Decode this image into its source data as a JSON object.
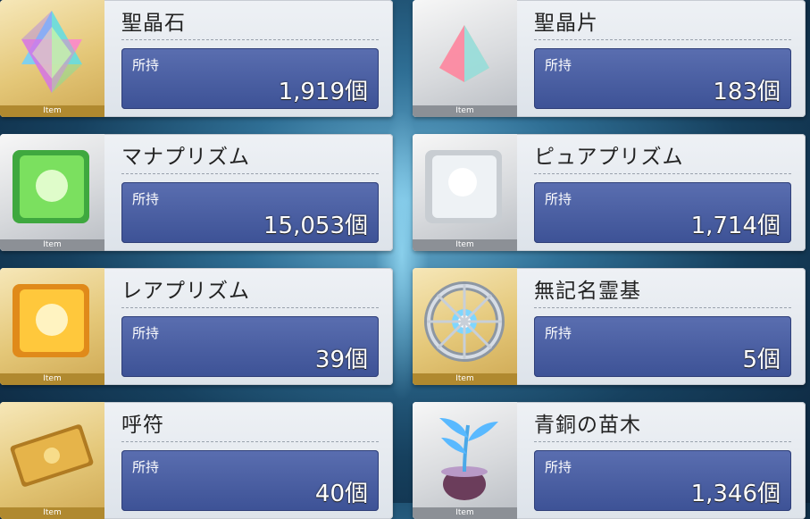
{
  "items": [
    {
      "name": "聖晶石",
      "own_label": "所持",
      "count": "1,919個",
      "tag": "Item",
      "icon": "saint-quartz-icon"
    },
    {
      "name": "聖晶片",
      "own_label": "所持",
      "count": "183個",
      "tag": "Item",
      "icon": "quartz-fragment-icon"
    },
    {
      "name": "マナプリズム",
      "own_label": "所持",
      "count": "15,053個",
      "tag": "Item",
      "icon": "mana-prism-icon"
    },
    {
      "name": "ピュアプリズム",
      "own_label": "所持",
      "count": "1,714個",
      "tag": "Item",
      "icon": "pure-prism-icon"
    },
    {
      "name": "レアプリズム",
      "own_label": "所持",
      "count": "39個",
      "tag": "Item",
      "icon": "rare-prism-icon"
    },
    {
      "name": "無記名霊基",
      "own_label": "所持",
      "count": "5個",
      "tag": "Item",
      "icon": "unregistered-spirit-origin-icon"
    },
    {
      "name": "呼符",
      "own_label": "所持",
      "count": "40個",
      "tag": "Item",
      "icon": "summon-ticket-icon"
    },
    {
      "name": "青銅の苗木",
      "own_label": "所持",
      "count": "1,346個",
      "tag": "Item",
      "icon": "bronze-sapling-icon"
    }
  ],
  "colors": {
    "panel": "#3d5296",
    "gold_frame": "#b0892f",
    "silver_frame": "#8c9096"
  }
}
